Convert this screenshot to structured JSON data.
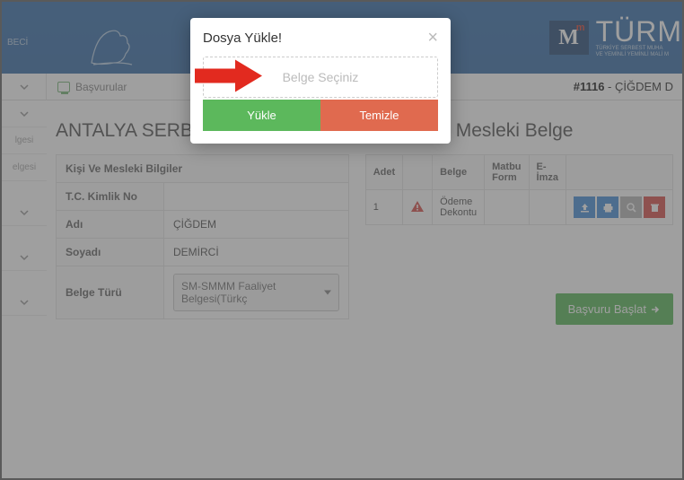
{
  "header": {
    "left_label": "BECİ",
    "logo": {
      "letter": "M",
      "sup": "m",
      "brand": "TÜRM",
      "sub1": "TÜRKİYE SERBEST MUHA",
      "sub2": "VE YEMİNLİ YEMİNLİ MALİ M"
    }
  },
  "subheader": {
    "basvurular": "Başvurular",
    "app_no_prefix": "#1116",
    "app_no_sep": " - ",
    "applicant_name": "ÇİĞDEM D"
  },
  "leftlabels": [
    "",
    "",
    "lgesi",
    "elgesi",
    "",
    "",
    "",
    ""
  ],
  "title_left": "ANTALYA SERBES",
  "title_right": "DASI Mesleki Belge",
  "personal": {
    "header": "Kişi Ve Mesleki Bilgiler",
    "rows": {
      "tc_label": "T.C. Kimlik No",
      "tc_val": "",
      "ad_label": "Adı",
      "ad_val": "ÇİĞDEM",
      "soyad_label": "Soyadı",
      "soyad_val": "DEMİRCİ",
      "belge_label": "Belge Türü",
      "belge_val": "SM-SMMM Faaliyet Belgesi(Türkç"
    }
  },
  "docs": {
    "headers": {
      "adet": "Adet",
      "empty": "",
      "belge": "Belge",
      "matbu": "Matbu Form",
      "eimza": "E-İmza",
      "actions": ""
    },
    "row": {
      "adet": "1",
      "belge": "Ödeme Dekontu"
    }
  },
  "start_btn": "Başvuru Başlat",
  "modal": {
    "title": "Dosya Yükle!",
    "placeholder": "Belge Seçiniz",
    "upload": "Yükle",
    "clear": "Temizle"
  }
}
